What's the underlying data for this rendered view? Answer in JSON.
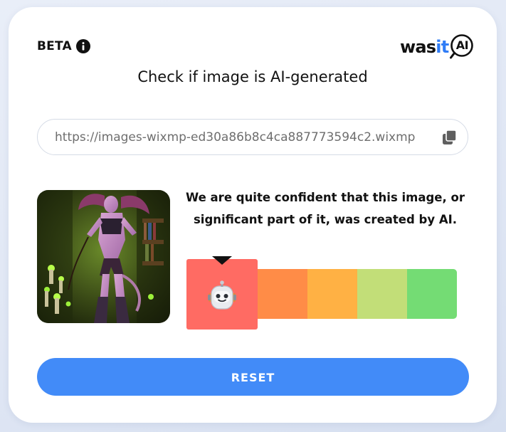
{
  "header": {
    "beta_label": "BETA",
    "info_icon": "info-icon",
    "logo": {
      "text_main": "was",
      "text_accent": "it",
      "text_badge": "AI",
      "accent_color": "#2f7cf6"
    }
  },
  "title": "Check if image is AI-generated",
  "url_input": {
    "value": "https://images-wixmp-ed30a86b8c4ca887773594c2.wixmp",
    "copy_icon": "copy-icon"
  },
  "result": {
    "verdict_line1": "We are quite confident that this image, or",
    "verdict_line2": "significant part of it, was created by AI.",
    "scale": {
      "active_index": 0,
      "active_icon": "robot-face-icon",
      "colors": [
        "#ff6b63",
        "#ff8c47",
        "#ffb144",
        "#c2de78",
        "#74dc74"
      ]
    },
    "thumbnail_icon": "uploaded-image-thumbnail"
  },
  "actions": {
    "reset_label": "RESET",
    "reset_color": "#428bf8"
  }
}
